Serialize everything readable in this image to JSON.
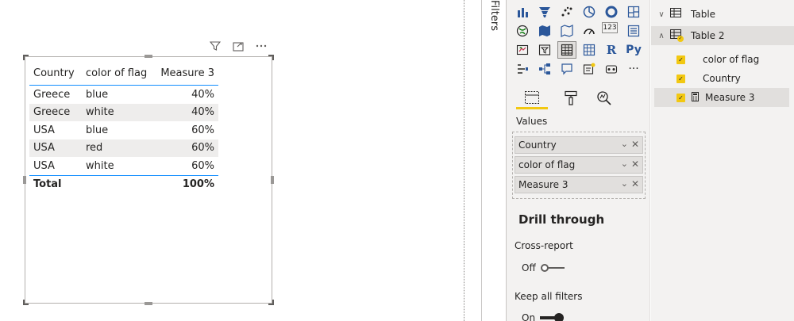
{
  "table_visual": {
    "columns": [
      "Country",
      "color of flag",
      "Measure 3"
    ],
    "rows": [
      {
        "country": "Greece",
        "color": "blue",
        "measure": "40%"
      },
      {
        "country": "Greece",
        "color": "white",
        "measure": "40%"
      },
      {
        "country": "USA",
        "color": "blue",
        "measure": "60%"
      },
      {
        "country": "USA",
        "color": "red",
        "measure": "60%"
      },
      {
        "country": "USA",
        "color": "white",
        "measure": "60%"
      }
    ],
    "total_label": "Total",
    "total_value": "100%",
    "header_icons": [
      "filter-icon",
      "focus-mode-icon",
      "more-options-icon"
    ]
  },
  "filters_pane": {
    "label": "Filters"
  },
  "visualizations": {
    "gallery_icons": [
      "stacked-column-icon",
      "funnel-icon",
      "scatter-icon",
      "pie-icon",
      "donut-icon",
      "treemap-icon",
      "map-icon",
      "filled-map-icon",
      "shape-map-icon",
      "gauge-icon",
      "card-icon",
      "multi-row-card-icon",
      "kpi-icon",
      "slicer-icon",
      "table-icon",
      "matrix-icon",
      "r-visual-icon",
      "python-visual-icon",
      "key-influencers-icon",
      "decomposition-tree-icon",
      "qna-icon",
      "smart-narrative-icon",
      "paginated-report-icon",
      "more-visuals-icon"
    ],
    "text_labels": {
      "r-visual-icon": "R",
      "python-visual-icon": "Py",
      "card-icon": "123",
      "more-visuals-icon": "···"
    },
    "selected_icon": "table-icon",
    "tabs": [
      "fields-tab",
      "format-tab",
      "analytics-tab"
    ],
    "active_tab": "fields-tab",
    "values_label": "Values",
    "value_wells": [
      "Country",
      "color of flag",
      "Measure 3"
    ],
    "drill_through": {
      "title": "Drill through",
      "cross_report_label": "Cross-report",
      "cross_report_state": "Off",
      "keep_filters_label": "Keep all filters",
      "keep_filters_state": "On"
    }
  },
  "fields_pane": {
    "tables": [
      {
        "name": "Table",
        "expanded": false
      },
      {
        "name": "Table 2",
        "expanded": true
      }
    ],
    "table2_fields": [
      {
        "name": "color of flag",
        "checked": true,
        "type": "column"
      },
      {
        "name": "Country",
        "checked": true,
        "type": "column"
      },
      {
        "name": "Measure 3",
        "checked": true,
        "type": "measure"
      }
    ]
  },
  "colors": {
    "accent_yellow": "#f2c811",
    "table_rule_blue": "#118dff",
    "pane_bg": "#f3f2f1"
  }
}
